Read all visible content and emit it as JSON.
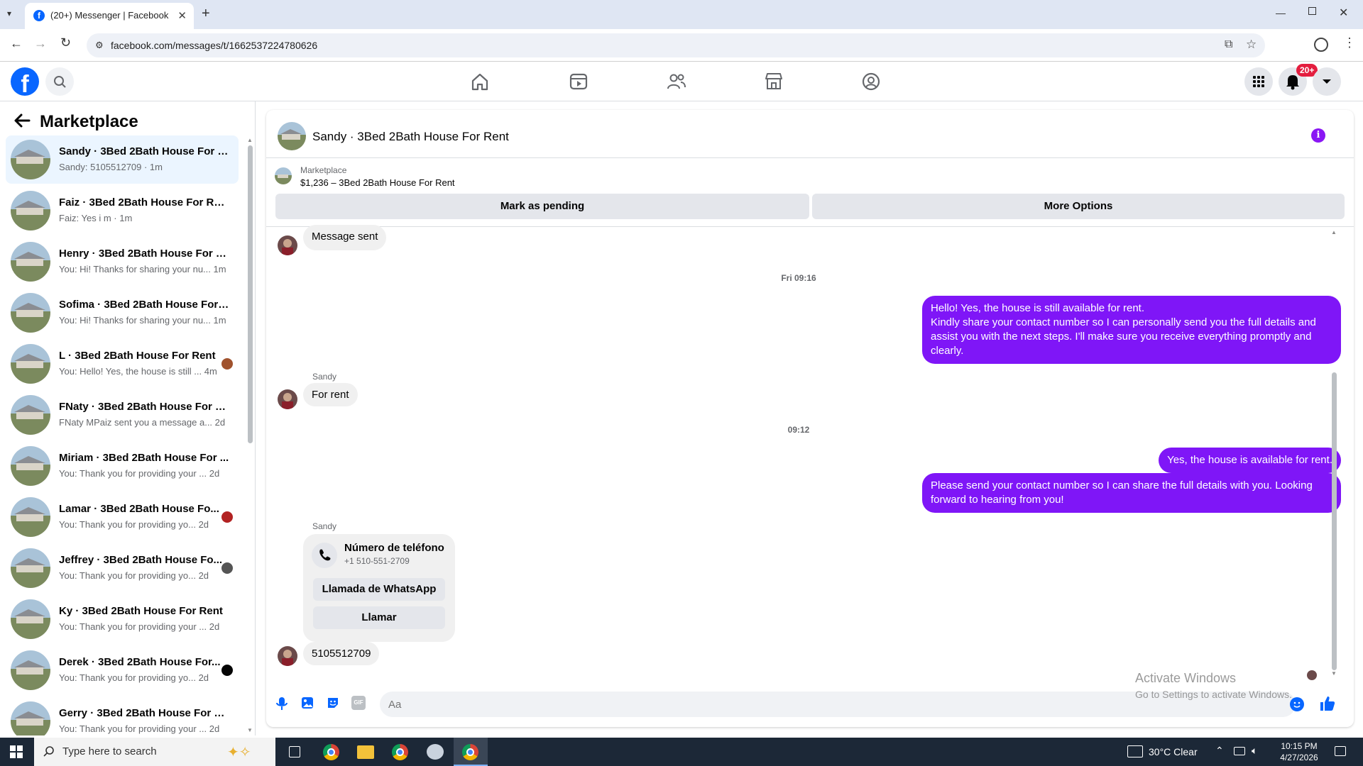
{
  "browser": {
    "tab_title": "(20+) Messenger | Facebook",
    "url": "facebook.com/messages/t/1662537224780626"
  },
  "fb": {
    "notif_badge": "20+"
  },
  "sidebar": {
    "title": "Marketplace",
    "conversations": [
      {
        "name": "Sandy · 3Bed 2Bath House For R...",
        "preview": "Sandy: 5105512709 · 1m"
      },
      {
        "name": "Faiz · 3Bed 2Bath House For Rent",
        "preview": "Faiz: Yes i m · 1m"
      },
      {
        "name": "Henry · 3Bed 2Bath House For R...",
        "preview": "You: Hi! Thanks for sharing your nu...  1m"
      },
      {
        "name": "Sofima · 3Bed 2Bath House For ...",
        "preview": "You: Hi! Thanks for sharing your nu...  1m"
      },
      {
        "name": "L · 3Bed 2Bath House For Rent",
        "preview": "You: Hello! Yes, the house is still ...  4m"
      },
      {
        "name": "FNaty · 3Bed 2Bath House For R...",
        "preview": "FNaty MPaiz sent you a message a...  2d"
      },
      {
        "name": "Miriam · 3Bed 2Bath House For ...",
        "preview": "You: Thank you for providing your ...  2d"
      },
      {
        "name": "Lamar · 3Bed 2Bath House Fo...",
        "preview": "You: Thank you for providing yo...  2d"
      },
      {
        "name": "Jeffrey · 3Bed 2Bath House Fo...",
        "preview": "You: Thank you for providing yo...  2d"
      },
      {
        "name": "Ky · 3Bed 2Bath House For Rent",
        "preview": "You: Thank you for providing your ...  2d"
      },
      {
        "name": "Derek · 3Bed 2Bath House For...",
        "preview": "You: Thank you for providing yo...  2d"
      },
      {
        "name": "Gerry · 3Bed 2Bath House For R...",
        "preview": "You: Thank you for providing your ...  2d"
      }
    ]
  },
  "chat": {
    "header_name": "Sandy · 3Bed 2Bath House For Rent",
    "listing_source": "Marketplace",
    "listing_title": "$1,236 – 3Bed 2Bath House For Rent",
    "mark_pending": "Mark as pending",
    "more_options": "More Options",
    "msg_sent": "Message sent",
    "ts1": "Fri 09:16",
    "out1_l1": "Hello! Yes, the house is still available for rent.",
    "out1_l2": "Kindly share your contact number so I can personally send you the full details and assist you with the next steps. I'll make sure you receive everything promptly and clearly.",
    "sender1": "Sandy",
    "in1": "For rent",
    "ts2": "09:12",
    "out2": "Yes, the house is available for rent.",
    "out3": "Please send your contact number so I can share the full details with you. Looking forward to hearing from you!",
    "sender2": "Sandy",
    "card_title": "Número de teléfono",
    "card_phone": "+1 510-551-2709",
    "card_whatsapp": "Llamada de WhatsApp",
    "card_call": "Llamar",
    "in2": "5105512709",
    "input_placeholder": "Aa"
  },
  "watermark": {
    "line1": "Activate Windows",
    "line2": "Go to Settings to activate Windows."
  },
  "taskbar": {
    "search_placeholder": "Type here to search",
    "weather": "30°C  Clear",
    "time": "10:15 PM",
    "date": "4/27/2026"
  },
  "colors": {
    "fb_blue": "#0866ff",
    "outgoing_bubble": "#7f16f7"
  }
}
